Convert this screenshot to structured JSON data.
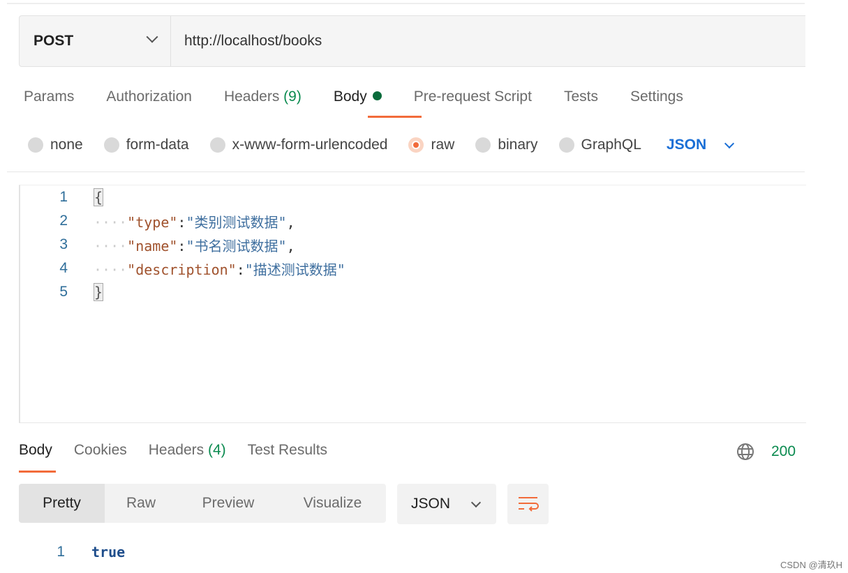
{
  "request": {
    "method": "POST",
    "url": "http://localhost/books"
  },
  "tabs": [
    {
      "label": "Params"
    },
    {
      "label": "Authorization"
    },
    {
      "label": "Headers",
      "count": "(9)"
    },
    {
      "label": "Body"
    },
    {
      "label": "Pre-request Script"
    },
    {
      "label": "Tests"
    },
    {
      "label": "Settings"
    }
  ],
  "body_types": [
    "none",
    "form-data",
    "x-www-form-urlencoded",
    "raw",
    "binary",
    "GraphQL"
  ],
  "selected_body_type": "raw",
  "raw_format": "JSON",
  "editor": {
    "lines": [
      {
        "n": "1",
        "open": "{"
      },
      {
        "n": "2",
        "key": "\"type\"",
        "value": "\"类别测试数据\"",
        "comma": ","
      },
      {
        "n": "3",
        "key": "\"name\"",
        "value": "\"书名测试数据\"",
        "comma": ","
      },
      {
        "n": "4",
        "key": "\"description\"",
        "value": "\"描述测试数据\"",
        "comma": ""
      },
      {
        "n": "5",
        "close": "}"
      }
    ]
  },
  "response": {
    "tabs": [
      {
        "label": "Body"
      },
      {
        "label": "Cookies"
      },
      {
        "label": "Headers",
        "count": "(4)"
      },
      {
        "label": "Test Results"
      }
    ],
    "status": "200",
    "views": [
      "Pretty",
      "Raw",
      "Preview",
      "Visualize"
    ],
    "format": "JSON",
    "lines": [
      {
        "n": "1",
        "text": "true"
      }
    ]
  },
  "colors": {
    "accent": "#f26b3a",
    "success": "#0a8a4f",
    "link": "#1a6fd6"
  },
  "watermark": "CSDN @清玖H"
}
